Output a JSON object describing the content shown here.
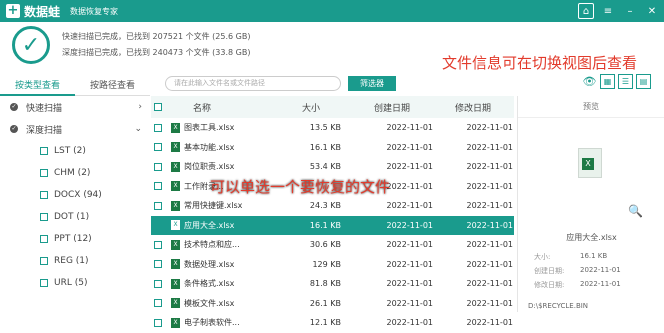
{
  "titlebar": {
    "app_name": "数据蛙",
    "subtitle": "数据恢复专家"
  },
  "status": {
    "quick_scan": "快速扫描已完成，已找到 207521 个文件 (25.6 GB)",
    "deep_scan": "深度扫描已完成，已找到 240473 个文件 (33.8 GB)"
  },
  "annotations": {
    "right": "文件信息可在切换视图后查看",
    "middle": "可以单选一个要恢复的文件"
  },
  "tabs": [
    {
      "label": "按类型查看"
    },
    {
      "label": "按路径查看"
    }
  ],
  "tree": [
    {
      "label": "快速扫描",
      "level": 0
    },
    {
      "label": "深度扫描",
      "level": 0
    },
    {
      "label": "LST (2)",
      "level": 1
    },
    {
      "label": "CHM (2)",
      "level": 1
    },
    {
      "label": "DOCX (94)",
      "level": 1
    },
    {
      "label": "DOT (1)",
      "level": 1
    },
    {
      "label": "PPT (12)",
      "level": 1
    },
    {
      "label": "REG (1)",
      "level": 1
    },
    {
      "label": "URL (5)",
      "level": 1
    }
  ],
  "search": {
    "placeholder": "请在此输入文件名或文件路径"
  },
  "filter_label": "筛选器",
  "grid": {
    "headers": {
      "name": "名称",
      "size": "大小",
      "created": "创建日期",
      "modified": "修改日期"
    },
    "rows": [
      {
        "name": "图表工具.xlsx",
        "size": "13.5 KB",
        "created": "2022-11-01",
        "modified": "2022-11-01"
      },
      {
        "name": "基本功能.xlsx",
        "size": "16.1 KB",
        "created": "2022-11-01",
        "modified": "2022-11-01"
      },
      {
        "name": "岗位职责.xlsx",
        "size": "53.4 KB",
        "created": "2022-11-01",
        "modified": "2022-11-01"
      },
      {
        "name": "工作附录...",
        "size": "",
        "created": "2022-11-01",
        "modified": "2022-11-01"
      },
      {
        "name": "常用快捷键.xlsx",
        "size": "24.3 KB",
        "created": "2022-11-01",
        "modified": "2022-11-01"
      },
      {
        "name": "应用大全.xlsx",
        "size": "16.1 KB",
        "created": "2022-11-01",
        "modified": "2022-11-01"
      },
      {
        "name": "技术特点和应...",
        "size": "30.6 KB",
        "created": "2022-11-01",
        "modified": "2022-11-01"
      },
      {
        "name": "数据处理.xlsx",
        "size": "129 KB",
        "created": "2022-11-01",
        "modified": "2022-11-01"
      },
      {
        "name": "条件格式.xlsx",
        "size": "81.8 KB",
        "created": "2022-11-01",
        "modified": "2022-11-01"
      },
      {
        "name": "模板文件.xlsx",
        "size": "26.1 KB",
        "created": "2022-11-01",
        "modified": "2022-11-01"
      },
      {
        "name": "电子制表软件...",
        "size": "12.1 KB",
        "created": "2022-11-01",
        "modified": "2022-11-01"
      }
    ]
  },
  "preview": {
    "title": "预览",
    "filename": "应用大全.xlsx",
    "size_label": "大小:",
    "size": "16.1 KB",
    "created_label": "创建日期:",
    "created": "2022-11-01",
    "modified_label": "修改日期:",
    "modified": "2022-11-01",
    "path": "D:\\$RECYCLE.BIN"
  },
  "colors": {
    "accent": "#1a9b8d",
    "annotation": "#e23b2c"
  }
}
